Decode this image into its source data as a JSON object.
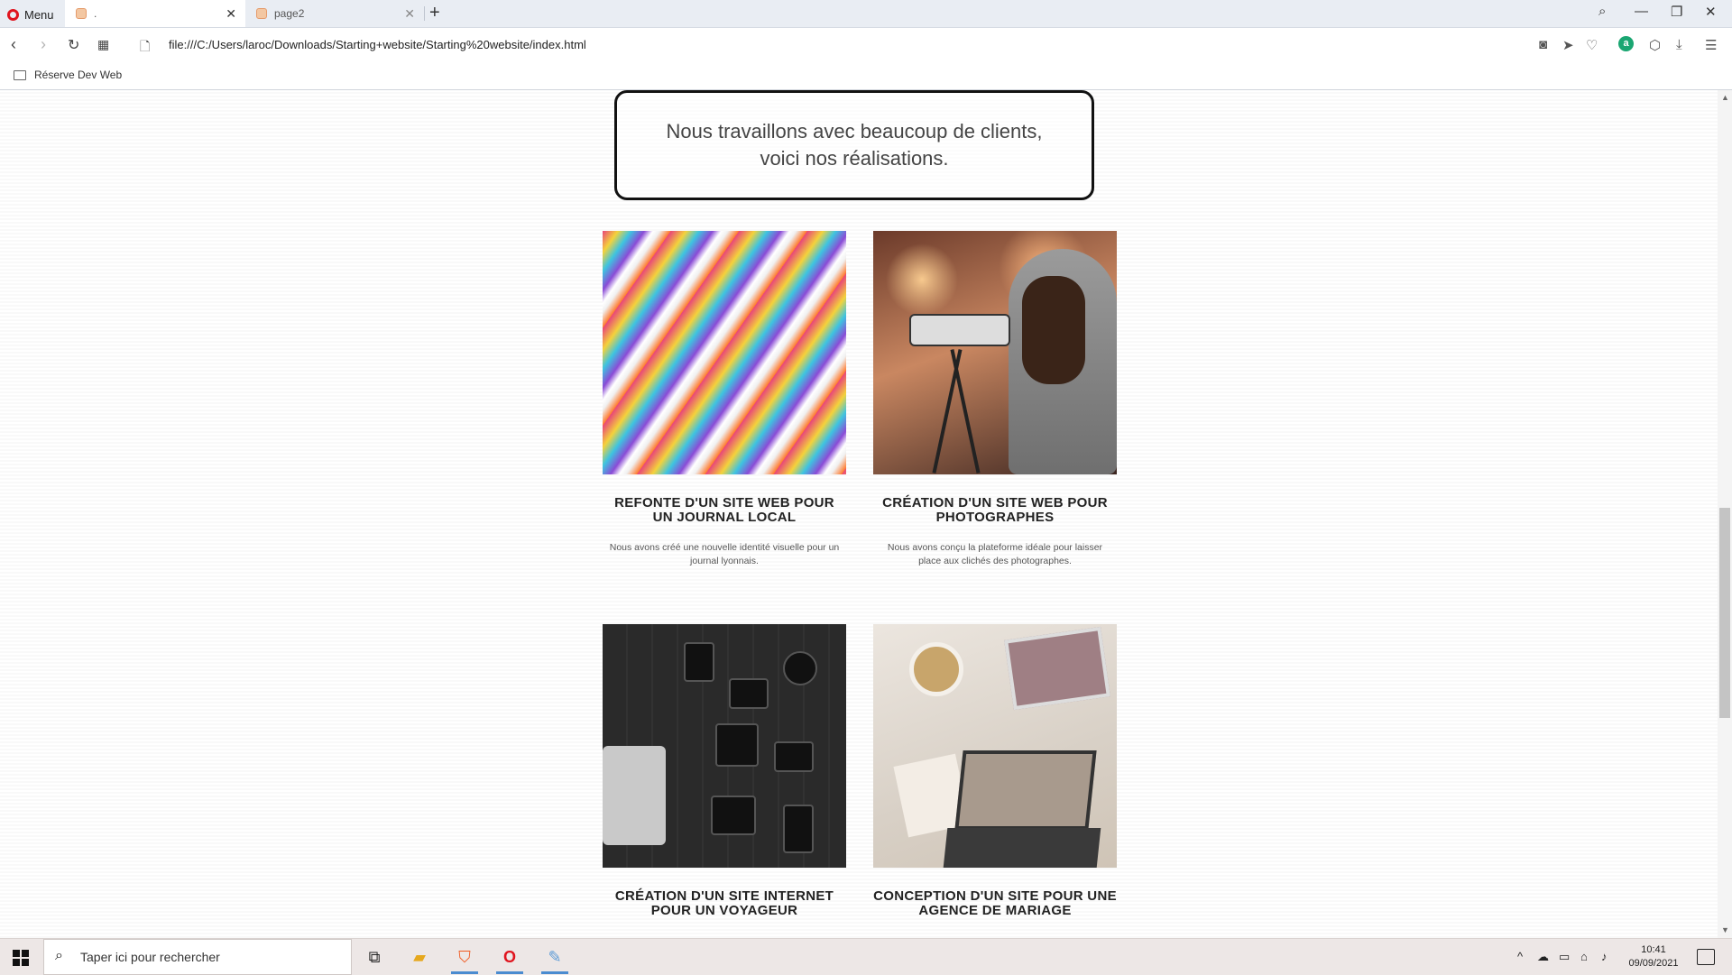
{
  "browser": {
    "menu_label": "Menu",
    "tabs": [
      {
        "title": "."
      },
      {
        "title": "page2"
      }
    ],
    "new_tab": "+",
    "url": "file:///C:/Users/laroc/Downloads/Starting+website/Starting%20website/index.html",
    "bookmarks": [
      {
        "label": "Réserve Dev Web"
      }
    ],
    "account_letter": "a"
  },
  "page": {
    "intro": "Nous travaillons avec beaucoup de clients, voici nos réalisations.",
    "projects": [
      {
        "title": "REFONTE D'UN SITE WEB POUR UN JOURNAL LOCAL",
        "description": "Nous avons créé une nouvelle identité visuelle pour un journal lyonnais.",
        "image": "magazines-photo"
      },
      {
        "title": "CRÉATION D'UN SITE WEB POUR PHOTOGRAPHES",
        "description": "Nous avons conçu la plateforme idéale pour laisser place aux clichés des photographes.",
        "image": "photographer-photo"
      },
      {
        "title": "CRÉATION D'UN SITE INTERNET POUR UN VOYAGEUR",
        "description": "",
        "image": "travel-gear-photo"
      },
      {
        "title": "CONCEPTION D'UN SITE POUR UNE AGENCE DE MARIAGE",
        "description": "",
        "image": "wedding-desk-photo"
      }
    ]
  },
  "taskbar": {
    "search_placeholder": "Taper ici pour rechercher",
    "time": "10:41",
    "date": "09/09/2021",
    "apps": [
      "task-view",
      "file-explorer",
      "brave",
      "opera",
      "paint"
    ]
  }
}
